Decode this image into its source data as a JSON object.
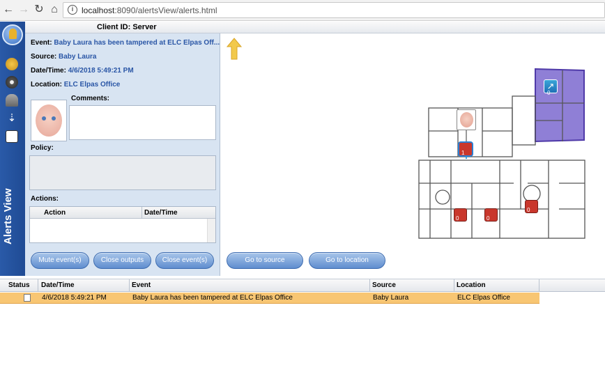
{
  "browser": {
    "url_host": "localhost",
    "url_rest": ":8090/alertsView/alerts.html"
  },
  "header": {
    "client_id": "Client ID: Server"
  },
  "sidebar": {
    "title": "Alerts View"
  },
  "details": {
    "event_label": "Event:",
    "event_value": "Baby Laura has been tampered at ELC Elpas Off...",
    "source_label": "Source:",
    "source_value": "Baby Laura",
    "datetime_label": "Date/Time:",
    "datetime_value": "4/6/2018 5:49:21 PM",
    "location_label": "Location:",
    "location_value": "ELC Elpas Office",
    "comments_label": "Comments:",
    "policy_label": "Policy:",
    "actions_label": "Actions:",
    "actions_columns": [
      "Action",
      "Date/Time"
    ]
  },
  "buttons": {
    "mute": "Mute event(s)",
    "close_outputs": "Close outputs",
    "close_events": "Close event(s)",
    "go_source": "Go to source",
    "go_location": "Go to location"
  },
  "map": {
    "badges": [
      "0",
      "1",
      "0",
      "0",
      "0"
    ]
  },
  "grid": {
    "columns": [
      "Status",
      "Date/Time",
      "Event",
      "Source",
      "Location"
    ],
    "rows": [
      {
        "datetime": "4/6/2018 5:49:21 PM",
        "event": "Baby Laura has been tampered at ELC Elpas Office",
        "source": "Baby Laura",
        "location": "ELC Elpas Office"
      }
    ]
  },
  "colors": {
    "accent": "#2a56a6",
    "sidebar": "#1f4b94",
    "selected_row": "#f8c673",
    "zone_fill": "#8f7fd6",
    "alarm_icon": "#c9372c"
  }
}
